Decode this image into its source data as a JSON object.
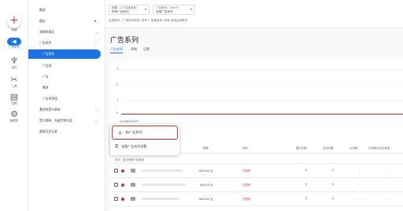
{
  "rail": {
    "items": [
      {
        "label": "创建",
        "icon": "plus-icon"
      },
      {
        "label": "广告系列",
        "icon": "campaigns-icon"
      },
      {
        "label": "目标",
        "icon": "goals-icon"
      },
      {
        "label": "工具",
        "icon": "tools-icon"
      },
      {
        "label": "结算",
        "icon": "billing-icon"
      },
      {
        "label": "管理员",
        "icon": "admin-icon"
      }
    ]
  },
  "nav": {
    "items": [
      {
        "label": "概述"
      },
      {
        "label": "建议"
      },
      {
        "label": "洞察和报告"
      },
      {
        "label": "广告系列"
      },
      {
        "label": "广告系列"
      },
      {
        "label": "广告组"
      },
      {
        "label": "广告"
      },
      {
        "label": "素材"
      },
      {
        "label": "广告系列组"
      },
      {
        "label": "素材和受众群体"
      },
      {
        "label": "受众群体、关键字和内容"
      },
      {
        "label": "更改历史记录"
      }
    ]
  },
  "topbar": {
    "selector1": {
      "small": "视图（1个过滤条件）",
      "main": "所有广告系列"
    },
    "selector2": {
      "small": "广告系列（180个）",
      "main": "选择广告系列"
    },
    "filters": "过滤条件：广告系列状态: 所有   广告组状态: 所有   添加过滤条件"
  },
  "main": {
    "title": "广告系列",
    "tabs": [
      "广告系列",
      "草稿",
      "设置"
    ]
  },
  "chart": {
    "y_ticks": [
      "3",
      "2",
      "1",
      "0"
    ],
    "x_label": "2024年9月18日"
  },
  "popover": {
    "new_campaign": "新广告系列",
    "load_settings": "加载广告系列设置"
  },
  "table": {
    "headers": [
      "预算",
      "状态",
      "展示次数",
      "点击次数",
      "点击率",
      "平均每次点击费用"
    ],
    "total_label": "总计：显示所有广告系列",
    "rows": [
      {
        "budget": "1000.00 元",
        "status": "已暂停",
        "impressions": "0",
        "clicks": "0",
        "ctr": "–",
        "cpc": "–"
      },
      {
        "budget": "400.00 元",
        "status": "已暂停",
        "impressions": "0",
        "clicks": "0",
        "ctr": "–",
        "cpc": "–"
      },
      {
        "budget": "1000.00 元",
        "status": "已暂停",
        "impressions": "0",
        "clicks": "0",
        "ctr": "–",
        "cpc": "–"
      }
    ]
  }
}
